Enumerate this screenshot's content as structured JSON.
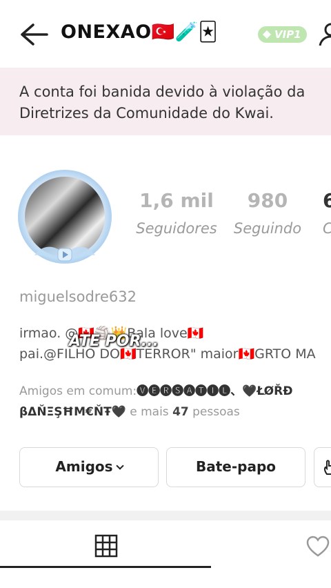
{
  "header": {
    "title": "ONEXAO🇹🇷🧪🃏",
    "vip_label": "VIP1"
  },
  "ban_notice": {
    "text": "A conta foi banida devido à violação da\nDiretrizes da Comunidade do Kwai."
  },
  "profile": {
    "followers_value": "1,6 mil",
    "followers_label": "Seguidores",
    "following_value": "980",
    "following_label": "Seguindo",
    "third_stat_value": "6",
    "third_stat_label": "C",
    "username": "miguelsodre632",
    "bio_line1": "irmao. @🇨🇦🏐👑Bala love🇨🇦",
    "bio_line2": "pai.@FILHO DO🇨🇦TERROR\" maior🇨🇦GRTO MA",
    "bio_overlay": "ATE POR..."
  },
  "mutual_friends": {
    "prefix": "Amigos em comum:",
    "names": "🅥🅔🅡🅢🅐🅣🅘🅛、🖤ŁØŘĐ βΔŇΞŞĦM€ŇŦ🖤",
    "suffix_pre": " e mais ",
    "count": "47",
    "suffix_post": " pessoas"
  },
  "actions": {
    "friends_label": "Amigos",
    "chat_label": "Bate-papo"
  },
  "colors": {
    "banner_bg": "#f7ecef",
    "vip_badge": "#bfe6b0"
  }
}
